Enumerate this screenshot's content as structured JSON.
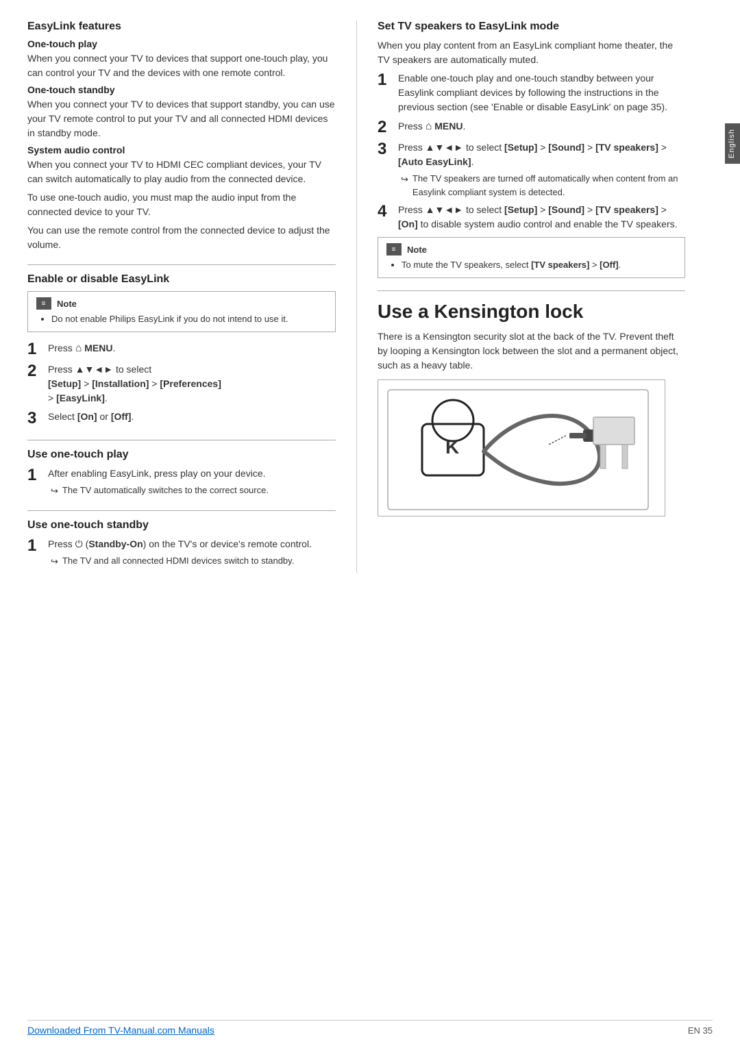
{
  "side_tab": "English",
  "left": {
    "easylink_features": {
      "title": "EasyLink features",
      "one_touch_play_title": "One-touch play",
      "one_touch_play_text": "When you connect your TV to devices that support one-touch play, you can control your TV and the devices with one remote control.",
      "one_touch_standby_title": "One-touch standby",
      "one_touch_standby_text": "When you connect your TV to devices that support standby, you can use your TV remote control to put your TV and all connected HDMI devices in standby mode.",
      "system_audio_title": "System audio control",
      "system_audio_text1": "When you connect your TV to HDMI CEC compliant devices, your TV can switch automatically to play audio from the connected device.",
      "system_audio_text2": "To use one-touch audio, you must map the audio input from the connected device to your TV.",
      "system_audio_text3": "You can use the remote control from the connected device to adjust the volume."
    },
    "enable_disable": {
      "title": "Enable or disable EasyLink",
      "note_label": "Note",
      "note_text": "Do not enable Philips EasyLink if you do not intend to use it.",
      "steps": [
        {
          "number": "1",
          "text": "Press",
          "menu_symbol": "⌂",
          "menu_text": "MENU."
        },
        {
          "number": "2",
          "text": "Press ▲▼◄► to select [Setup] > [Installation] > [Preferences] > [EasyLink]."
        },
        {
          "number": "3",
          "text": "Select [On] or [Off]."
        }
      ]
    },
    "one_touch_play_section": {
      "title": "Use one-touch play",
      "steps": [
        {
          "number": "1",
          "text": "After enabling EasyLink, press play on your device.",
          "sub_bullet": "The TV automatically switches to the correct source."
        }
      ]
    },
    "one_touch_standby_section": {
      "title": "Use one-touch standby",
      "steps": [
        {
          "number": "1",
          "text": "Press ⏻ (Standby-On) on the TV's or device's remote control.",
          "sub_bullet": "The TV and all connected HDMI devices switch to standby."
        }
      ]
    }
  },
  "right": {
    "set_tv_speakers": {
      "title": "Set TV speakers to EasyLink mode",
      "intro": "When you play content from an EasyLink compliant home theater, the TV speakers are automatically muted.",
      "steps": [
        {
          "number": "1",
          "text": "Enable one-touch play and one-touch standby between your Easylink compliant devices by following the instructions in the previous section (see 'Enable or disable EasyLink' on page 35)."
        },
        {
          "number": "2",
          "text": "Press",
          "menu_symbol": "⌂",
          "menu_text": "MENU."
        },
        {
          "number": "3",
          "text": "Press ▲▼◄► to select [Setup] > [Sound] > [TV speakers] > [Auto EasyLink].",
          "sub_bullet": "The TV speakers are turned off automatically when content from an Easylink compliant system is detected."
        },
        {
          "number": "4",
          "text": "Press ▲▼◄► to select [Setup] > [Sound] > [TV speakers] > [On] to disable system audio control and enable the TV speakers."
        }
      ],
      "note_label": "Note",
      "note_text": "To mute the TV speakers, select [TV speakers] > [Off]."
    },
    "kensington": {
      "title": "Use a Kensington lock",
      "description": "There is a Kensington security slot at the back of the TV. Prevent theft by looping a Kensington lock between the slot and a permanent object, such as a heavy table."
    }
  },
  "footer": {
    "link_text": "Downloaded From TV-Manual.com Manuals",
    "page_text": "EN   35"
  }
}
